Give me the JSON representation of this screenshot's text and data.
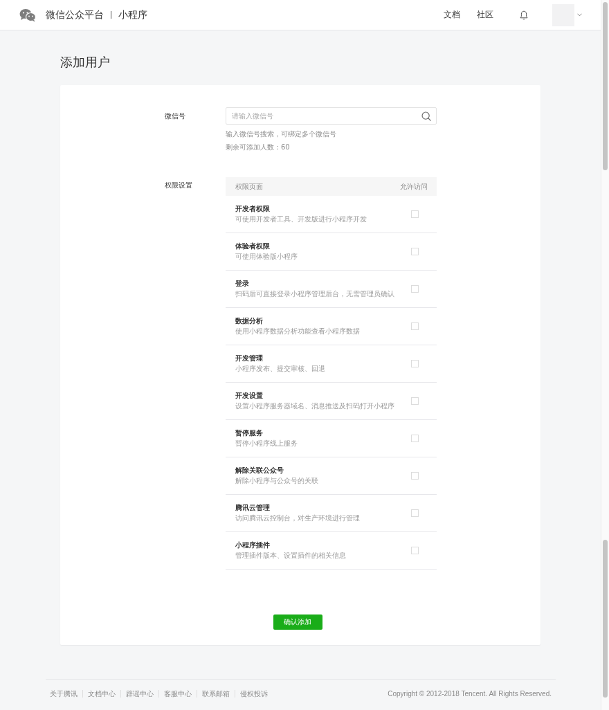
{
  "header": {
    "brand": "微信公众平台",
    "product": "小程序",
    "nav": [
      "文档",
      "社区"
    ]
  },
  "page_title": "添加用户",
  "form": {
    "wechat_id": {
      "label": "微信号",
      "placeholder": "请输入微信号",
      "hints": [
        "输入微信号搜索，可绑定多个微信号",
        "剩余可添加人数：60"
      ]
    },
    "permissions": {
      "label": "权限设置",
      "columns": [
        "权限页面",
        "允许访问"
      ],
      "rows": [
        {
          "title": "开发者权限",
          "description": "可使用开发者工具、开发版进行小程序开发",
          "checked": false
        },
        {
          "title": "体验者权限",
          "description": "可使用体验版小程序",
          "checked": false
        },
        {
          "title": "登录",
          "description": "扫码后可直接登录小程序管理后台，无需管理员确认",
          "checked": false
        },
        {
          "title": "数据分析",
          "description": "使用小程序数据分析功能查看小程序数据",
          "checked": false
        },
        {
          "title": "开发管理",
          "description": "小程序发布、提交审核、回退",
          "checked": false
        },
        {
          "title": "开发设置",
          "description": "设置小程序服务器域名、消息推送及扫码打开小程序",
          "checked": false
        },
        {
          "title": "暂停服务",
          "description": "暂停小程序线上服务",
          "checked": false
        },
        {
          "title": "解除关联公众号",
          "description": "解除小程序与公众号的关联",
          "checked": false
        },
        {
          "title": "腾讯云管理",
          "description": "访问腾讯云控制台，对生产环境进行管理",
          "checked": false
        },
        {
          "title": "小程序插件",
          "description": "管理插件版本、设置插件的相关信息",
          "checked": false
        }
      ]
    }
  },
  "submit": "确认添加",
  "footer": {
    "links": [
      "关于腾讯",
      "文档中心",
      "辟谣中心",
      "客服中心",
      "联系邮箱",
      "侵权投诉"
    ],
    "copyright": "Copyright © 2012-2018 Tencent. All Rights Reserved."
  }
}
